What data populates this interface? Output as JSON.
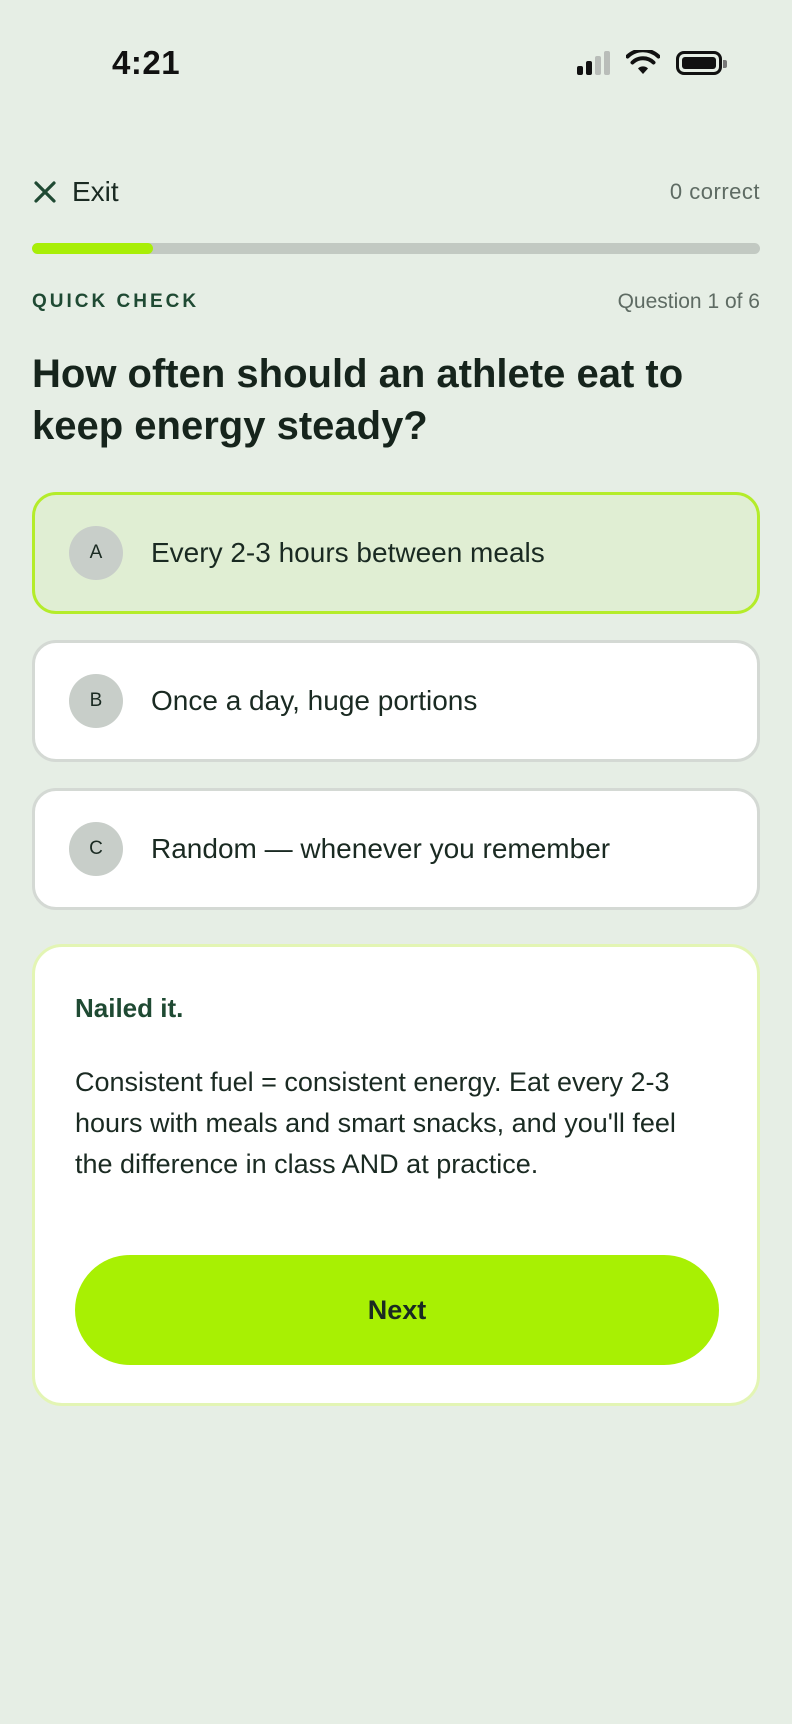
{
  "status_bar": {
    "time": "4:21"
  },
  "header": {
    "exit_label": "Exit",
    "correct_count": "0 correct"
  },
  "progress": {
    "fraction": 0.1667
  },
  "section": {
    "label": "QUICK CHECK",
    "counter": "Question 1 of 6"
  },
  "question": {
    "title": "How often should an athlete eat to keep energy steady?"
  },
  "options": [
    {
      "letter": "A",
      "text": "Every 2-3 hours between meals",
      "selected": true
    },
    {
      "letter": "B",
      "text": "Once a day, huge portions",
      "selected": false
    },
    {
      "letter": "C",
      "text": "Random — whenever you remember",
      "selected": false
    }
  ],
  "feedback": {
    "title": "Nailed it.",
    "body": "Consistent fuel = consistent energy. Eat every 2-3 hours with meals and smart snacks, and you'll feel the difference in class AND at practice.",
    "next_label": "Next"
  },
  "colors": {
    "accent": "#A8F003",
    "background": "#E6EEE5",
    "selected_bg": "#E0EED3",
    "selected_border": "#B4EC2A",
    "heading_green": "#1F4A33"
  },
  "icons": {
    "exit": "close-icon",
    "signal": "cellular-signal-icon",
    "wifi": "wifi-icon",
    "battery": "battery-icon"
  }
}
